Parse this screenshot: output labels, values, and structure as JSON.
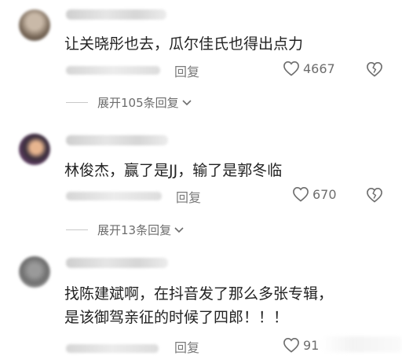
{
  "comments": [
    {
      "text": "让关晓彤也去，瓜尔佳氏也得出点力",
      "reply_label": "回复",
      "like_count": "4667",
      "expand_label": "展开105条回复"
    },
    {
      "text": "林俊杰，赢了是JJ，输了是郭冬临",
      "reply_label": "回复",
      "like_count": "670",
      "expand_label": "展开13条回复"
    },
    {
      "text_line1": "找陈建斌啊，在抖音发了那么多张专辑，",
      "text_line2": "是该御驾亲征的时候了四郎！！！",
      "reply_label": "回复",
      "like_count": "91"
    }
  ],
  "icons": {
    "like": "heart-outline-icon",
    "dislike": "broken-heart-icon",
    "expand": "chevron-down-icon"
  },
  "colors": {
    "text": "#222222",
    "meta": "#6d6d6d",
    "background": "#ffffff"
  }
}
